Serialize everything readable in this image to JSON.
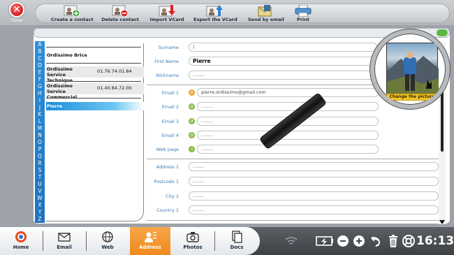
{
  "topbar": {
    "close_label": "Close",
    "buttons": [
      {
        "label": "Create a contact",
        "icon": "create-contact-icon"
      },
      {
        "label": "Delete contact",
        "icon": "delete-contact-icon"
      },
      {
        "label": "Import VCard",
        "icon": "import-vcard-icon"
      },
      {
        "label": "Export the VCard",
        "icon": "export-vcard-icon"
      },
      {
        "label": "Send by email",
        "icon": "send-email-icon"
      },
      {
        "label": "Print",
        "icon": "printer-icon"
      }
    ]
  },
  "alphabet": [
    "A",
    "B",
    "C",
    "D",
    "E",
    "F",
    "G",
    "H",
    "I",
    "J",
    "K",
    "L",
    "M",
    "N",
    "O",
    "P",
    "Q",
    "R",
    "S",
    "T",
    "U",
    "V",
    "W",
    "X",
    "Y",
    "Z"
  ],
  "contacts": [
    {
      "name": "Ordissimo Brice",
      "phone": ""
    },
    {
      "name": "Ordissimo Service Technique",
      "phone": "01.76.74.01.84"
    },
    {
      "name": "Ordissimo Service Commercial",
      "phone": "01.40.84.72.00"
    },
    {
      "name": "Pierre",
      "phone": "",
      "selected": true
    }
  ],
  "form": {
    "surname": {
      "label": "Surname",
      "value": "|"
    },
    "first_name": {
      "label": "First Name",
      "value": "Pierre"
    },
    "nickname": {
      "label": "Nickname",
      "value": "........"
    },
    "email1": {
      "label": "Email 1",
      "value": "pierre.ordissimo@gmail.com"
    },
    "email2": {
      "label": "Email 2",
      "value": "........"
    },
    "email3": {
      "label": "Email 3",
      "value": "........"
    },
    "email4": {
      "label": "Email 4",
      "value": "........"
    },
    "webpage": {
      "label": "Web page",
      "value": "........"
    },
    "address1": {
      "label": "Address 1",
      "value": "........"
    },
    "postcode1": {
      "label": "Postcode 1",
      "value": "........"
    },
    "city1": {
      "label": "City 1",
      "value": "........"
    },
    "country1": {
      "label": "Country 1",
      "value": "........"
    }
  },
  "photo": {
    "change_label": "Change the picture"
  },
  "bottom_nav": [
    {
      "label": "Home",
      "icon": "home-icon"
    },
    {
      "label": "Email",
      "icon": "email-icon"
    },
    {
      "label": "Web",
      "icon": "web-icon"
    },
    {
      "label": "Address",
      "icon": "address-icon",
      "active": true
    },
    {
      "label": "Photos",
      "icon": "camera-icon"
    },
    {
      "label": "Docs",
      "icon": "docs-icon"
    }
  ],
  "status": {
    "time": "16:13"
  },
  "colors": {
    "accent": "#ef8a1d",
    "alphabet_bar": "#2d8fd8",
    "field_label": "#3a7bb5",
    "ok_green": "#7cb637"
  }
}
